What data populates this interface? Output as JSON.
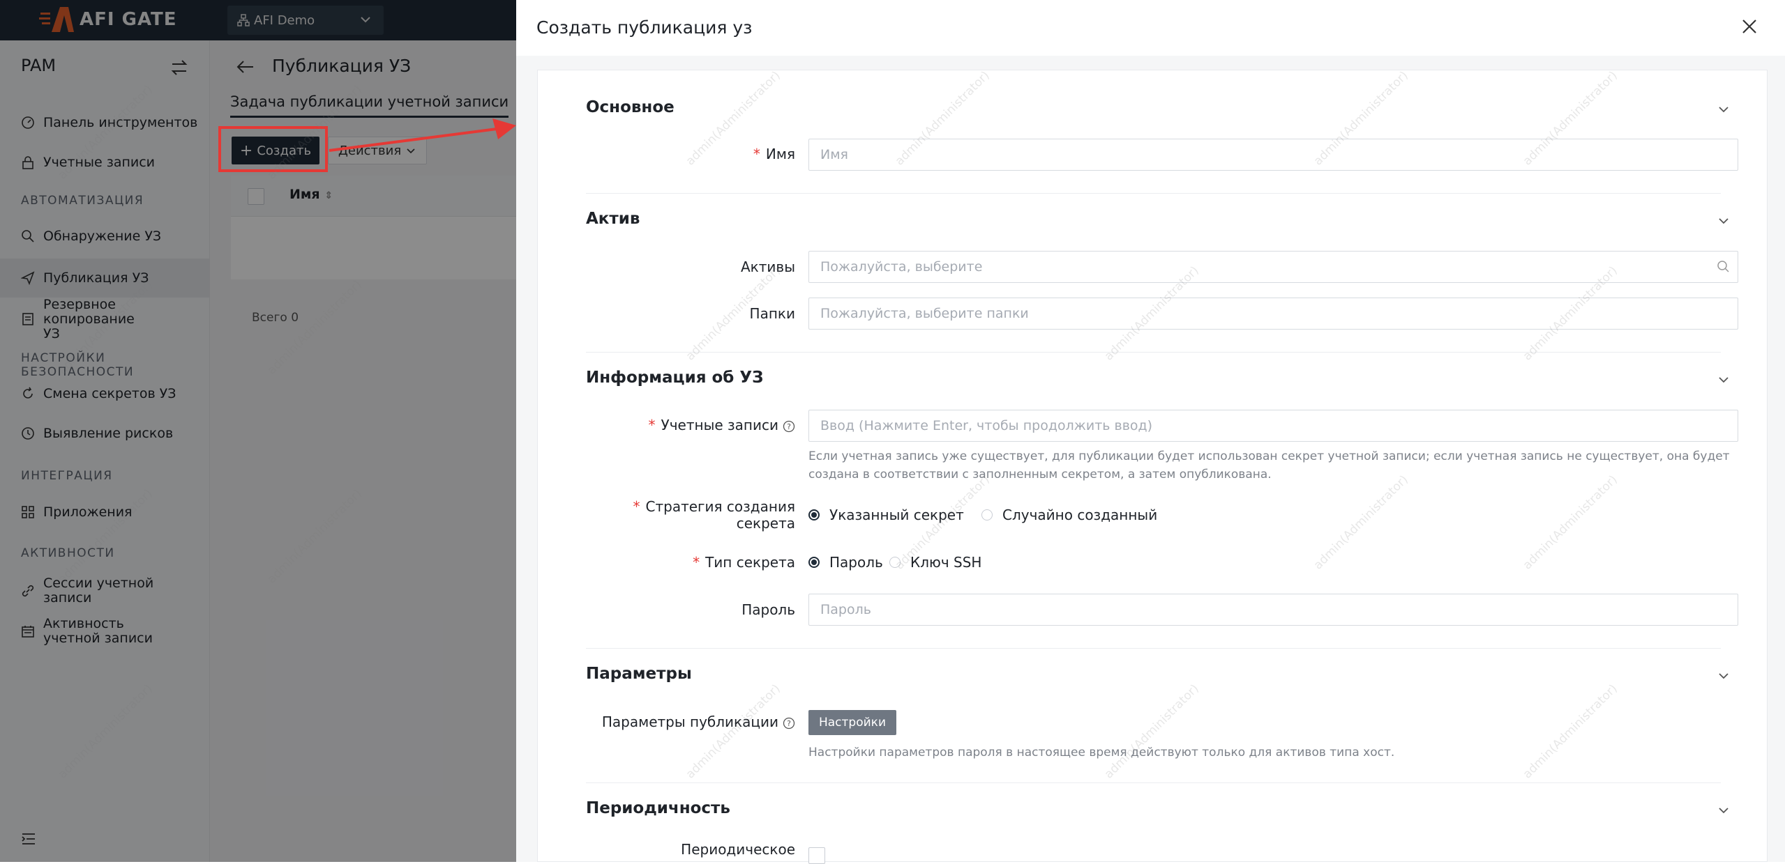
{
  "topbar": {
    "logo_text": "AFI GATE",
    "org_select_value": "AFI Demo"
  },
  "sidebar": {
    "header": "PAM",
    "items": [
      {
        "label": "Панель инструментов",
        "icon": "dashboard-icon"
      },
      {
        "label": "Учетные записи",
        "icon": "lock-icon"
      },
      {
        "label": "Обнаружение УЗ",
        "icon": "search-icon"
      },
      {
        "label": "Публикация УЗ",
        "icon": "send-icon"
      },
      {
        "label": "Резервное копирование УЗ",
        "icon": "backup-icon"
      },
      {
        "label": "Смена секретов УЗ",
        "icon": "rotate-icon"
      },
      {
        "label": "Выявление рисков",
        "icon": "clock-icon"
      },
      {
        "label": "Приложения",
        "icon": "apps-icon"
      },
      {
        "label": "Сессии учетной записи",
        "icon": "link-icon"
      },
      {
        "label": "Активность учетной записи",
        "icon": "calendar-icon"
      }
    ],
    "sections": {
      "automation": "АВТОМАТИЗАЦИЯ",
      "security": "НАСТРОЙКИ БЕЗОПАСНОСТИ",
      "integration": "ИНТЕГРАЦИЯ",
      "activity": "АКТИВНОСТИ"
    }
  },
  "main": {
    "page_title": "Публикация УЗ",
    "tab_label": "Задача публикации учетной записи",
    "create_button": "Создать",
    "actions_button": "Действия",
    "table": {
      "column_name": "Имя",
      "total": "Всего 0"
    }
  },
  "drawer": {
    "title": "Создать публикация уз",
    "sections": {
      "basic": "Основное",
      "asset": "Актив",
      "account_info": "Информация об УЗ",
      "params": "Параметры",
      "periodicity": "Периодичность"
    },
    "fields": {
      "name_label": "Имя",
      "name_placeholder": "Имя",
      "assets_label": "Активы",
      "assets_placeholder": "Пожалуйста, выберите",
      "folders_label": "Папки",
      "folders_placeholder": "Пожалуйста, выберите папки",
      "accounts_label": "Учетные записи",
      "accounts_placeholder": "Ввод (Нажмите Enter, чтобы продолжить ввод)",
      "accounts_hint_line1": "Если учетная запись уже существует, для публикации будет использован секрет учетной записи; если учетная запись не существует, она будет",
      "accounts_hint_line2": "создана в соответствии с заполненным секретом, а затем опубликована.",
      "strategy_label_line1": "Стратегия создания",
      "strategy_label_line2": "секрета",
      "strategy_option_specified": "Указанный секрет",
      "strategy_option_random": "Случайно созданный",
      "secret_type_label": "Тип секрета",
      "secret_type_password": "Пароль",
      "secret_type_ssh": "Ключ SSH",
      "password_label": "Пароль",
      "password_placeholder": "Пароль",
      "publish_params_label": "Параметры публикации",
      "settings_button": "Настройки",
      "params_hint": "Настройки параметров пароля в настоящее время действуют только для активов типа хост.",
      "periodic_label": "Периодическое"
    }
  },
  "watermark": "admin(Administrator)",
  "colors": {
    "topbar": "#1f2b38",
    "primary_button": "#1f2b38",
    "required": "#e53935",
    "highlight": "#e53935"
  }
}
